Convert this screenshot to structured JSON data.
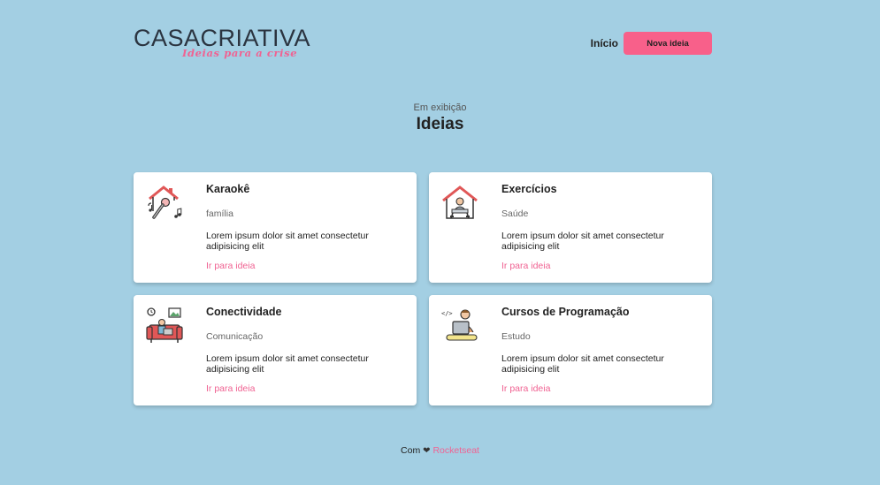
{
  "logo": {
    "part1": "CASA",
    "part2": "CRIATIVA",
    "tagline": "Ideias para a crise"
  },
  "nav": {
    "home_label": "Início",
    "new_idea_label": "Nova ideia"
  },
  "section": {
    "subtitle": "Em exibição",
    "title": "Ideias"
  },
  "ideas": [
    {
      "title": "Karaokê",
      "category": "família",
      "description": "Lorem ipsum dolor sit amet consectetur adipisicing elit",
      "link": "Ir para ideia",
      "icon": "karaoke-house-icon"
    },
    {
      "title": "Exercícios",
      "category": "Saúde",
      "description": "Lorem ipsum dolor sit amet consectetur adipisicing elit",
      "link": "Ir para ideia",
      "icon": "exercise-house-icon"
    },
    {
      "title": "Conectividade",
      "category": "Comunicação",
      "description": "Lorem ipsum dolor sit amet consectetur adipisicing elit",
      "link": "Ir para ideia",
      "icon": "sofa-laptop-icon"
    },
    {
      "title": "Cursos de Programação",
      "category": "Estudo",
      "description": "Lorem ipsum dolor sit amet consectetur adipisicing elit",
      "link": "Ir para ideia",
      "icon": "programmer-icon"
    }
  ],
  "footer": {
    "prefix": "Com",
    "heart": "❤",
    "brand": "Rocketseat"
  },
  "colors": {
    "background": "#a3cfe3",
    "accent": "#f8608a",
    "link": "#f06292"
  }
}
